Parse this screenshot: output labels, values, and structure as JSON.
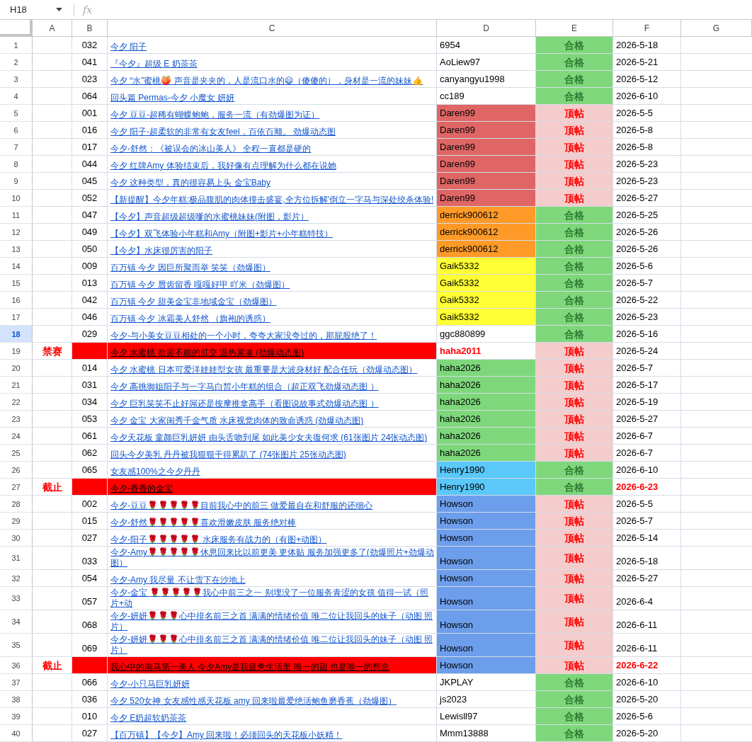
{
  "name_box": {
    "value": "H18"
  },
  "formula_bar": {
    "symbol": "fx"
  },
  "columns": [
    "A",
    "B",
    "C",
    "D",
    "E",
    "F",
    "G"
  ],
  "rows": [
    {
      "row_number": "1",
      "selected": false,
      "flagged": false,
      "column_b": "032",
      "column_c": "今夕 阳子",
      "column_d": {
        "text": "6954",
        "color": "#ffffff",
        "alert": false
      },
      "column_e": {
        "kind": "pass",
        "text": "合格"
      },
      "column_f": {
        "text": "2026-5-18",
        "alert": false
      }
    },
    {
      "row_number": "2",
      "selected": false,
      "flagged": false,
      "column_b": "041",
      "column_c": "『今夕』超级 E 奶茶茶",
      "column_d": {
        "text": "AoLiew97",
        "color": "#ffffff",
        "alert": false
      },
      "column_e": {
        "kind": "pass",
        "text": "合格"
      },
      "column_f": {
        "text": "2026-5-21",
        "alert": false
      }
    },
    {
      "row_number": "3",
      "selected": false,
      "flagged": false,
      "column_b": "023",
      "column_c": "今夕 “水”蜜桃🍑 声音是夹夹的，人是流口水的😄（傻傻的），身材是一流的妹妹👍",
      "column_d": {
        "text": "canyangyu1998",
        "color": "#ffffff",
        "alert": false
      },
      "column_e": {
        "kind": "pass",
        "text": "合格"
      },
      "column_f": {
        "text": "2026-5-12",
        "alert": false
      }
    },
    {
      "row_number": "4",
      "selected": false,
      "flagged": false,
      "column_b": "064",
      "column_c": "回头篇 Permas-今夕 小魔女 妍妍",
      "column_d": {
        "text": "cc189",
        "color": "#ffffff",
        "alert": false
      },
      "column_e": {
        "kind": "pass",
        "text": "合格"
      },
      "column_f": {
        "text": "2026-6-10",
        "alert": false
      }
    },
    {
      "row_number": "5",
      "selected": false,
      "flagged": false,
      "column_b": "001",
      "column_c": "今夕 豆豆-超稀有蝴蝶鲍鲍，服务一流（有劲爆图为证）",
      "column_d": {
        "text": "Daren99",
        "color": "#e06666",
        "alert": false
      },
      "column_e": {
        "kind": "bump",
        "text": "顶帖"
      },
      "column_f": {
        "text": "2026-5-5",
        "alert": false
      }
    },
    {
      "row_number": "6",
      "selected": false,
      "flagged": false,
      "column_b": "016",
      "column_c": "今夕 阳子-超柔软的非常有女友feel，百依百顺。 劲爆动态图",
      "column_d": {
        "text": "Daren99",
        "color": "#e06666",
        "alert": false
      },
      "column_e": {
        "kind": "bump",
        "text": "顶帖"
      },
      "column_f": {
        "text": "2026-5-8",
        "alert": false
      }
    },
    {
      "row_number": "7",
      "selected": false,
      "flagged": false,
      "column_b": "017",
      "column_c": "今夕-舒然：《被误会的冰山美人》 全程一直都是硬的",
      "column_d": {
        "text": "Daren99",
        "color": "#e06666",
        "alert": false
      },
      "column_e": {
        "kind": "bump",
        "text": "顶帖"
      },
      "column_f": {
        "text": "2026-5-8",
        "alert": false
      }
    },
    {
      "row_number": "8",
      "selected": false,
      "flagged": false,
      "column_b": "044",
      "column_c": "今夕 红牌Amy 体验结束后，我好像有点理解为什么都在说她",
      "column_d": {
        "text": "Daren99",
        "color": "#e06666",
        "alert": false
      },
      "column_e": {
        "kind": "bump",
        "text": "顶帖"
      },
      "column_f": {
        "text": "2026-5-23",
        "alert": false
      }
    },
    {
      "row_number": "9",
      "selected": false,
      "flagged": false,
      "column_b": "045",
      "column_c": "今夕 这种类型，真的很容易上头 金宝Baby",
      "column_d": {
        "text": "Daren99",
        "color": "#e06666",
        "alert": false
      },
      "column_e": {
        "kind": "bump",
        "text": "顶帖"
      },
      "column_f": {
        "text": "2026-5-23",
        "alert": false
      }
    },
    {
      "row_number": "10",
      "selected": false,
      "flagged": false,
      "column_b": "052",
      "column_c": "【新提醒】今夕年糕:极品腹肌的肉体撞击盛宴,全方位拆解'倒立一字马与深处绞杀体验!",
      "column_d": {
        "text": "Daren99",
        "color": "#e06666",
        "alert": false
      },
      "column_e": {
        "kind": "bump",
        "text": "顶帖"
      },
      "column_f": {
        "text": "2026-5-27",
        "alert": false
      }
    },
    {
      "row_number": "11",
      "selected": false,
      "flagged": false,
      "column_b": "047",
      "column_c": "【今夕】声音超级超级嗲的水蜜桃妹妹(附图，影片）",
      "column_d": {
        "text": "derrick900612",
        "color": "#ff9a28",
        "alert": false
      },
      "column_e": {
        "kind": "pass",
        "text": "合格"
      },
      "column_f": {
        "text": "2026-5-25",
        "alert": false
      }
    },
    {
      "row_number": "12",
      "selected": false,
      "flagged": false,
      "column_b": "049",
      "column_c": "【今夕】双飞体验小年糕和Amy（附图+影片+小年糕特技）",
      "column_d": {
        "text": "derrick900612",
        "color": "#ff9a28",
        "alert": false
      },
      "column_e": {
        "kind": "pass",
        "text": "合格"
      },
      "column_f": {
        "text": "2026-5-26",
        "alert": false
      }
    },
    {
      "row_number": "13",
      "selected": false,
      "flagged": false,
      "column_b": "050",
      "column_c": "【今夕】水床很厉害的阳子",
      "column_d": {
        "text": "derrick900612",
        "color": "#ff9a28",
        "alert": false
      },
      "column_e": {
        "kind": "pass",
        "text": "合格"
      },
      "column_f": {
        "text": "2026-5-26",
        "alert": false
      }
    },
    {
      "row_number": "14",
      "selected": false,
      "flagged": false,
      "column_b": "009",
      "column_c": "百万镇 今夕 因巨所聚而举 笑笑（劲爆图）",
      "column_d": {
        "text": "Gaik5332",
        "color": "#ffff33",
        "alert": false
      },
      "column_e": {
        "kind": "pass",
        "text": "合格"
      },
      "column_f": {
        "text": "2026-5-6",
        "alert": false
      }
    },
    {
      "row_number": "15",
      "selected": false,
      "flagged": false,
      "column_b": "013",
      "column_c": "百万镇 今夕 唇齿留香 嘎嘎好甲 吖米（劲爆图）",
      "column_d": {
        "text": "Gaik5332",
        "color": "#ffff33",
        "alert": false
      },
      "column_e": {
        "kind": "pass",
        "text": "合格"
      },
      "column_f": {
        "text": "2026-5-7",
        "alert": false
      }
    },
    {
      "row_number": "16",
      "selected": false,
      "flagged": false,
      "column_b": "042",
      "column_c": "百万镇 今夕 甜美金宝非地域金宝（劲爆图）",
      "column_d": {
        "text": "Gaik5332",
        "color": "#ffff33",
        "alert": false
      },
      "column_e": {
        "kind": "pass",
        "text": "合格"
      },
      "column_f": {
        "text": "2026-5-22",
        "alert": false
      }
    },
    {
      "row_number": "17",
      "selected": false,
      "flagged": false,
      "column_b": "046",
      "column_c": "百万镇 今夕 冰霜美人舒然 （旗袍的诱惑）",
      "column_d": {
        "text": "Gaik5332",
        "color": "#ffff33",
        "alert": false
      },
      "column_e": {
        "kind": "pass",
        "text": "合格"
      },
      "column_f": {
        "text": "2026-5-23",
        "alert": false
      }
    },
    {
      "row_number": "18",
      "selected": true,
      "flagged": false,
      "column_b": "029",
      "column_c": "今夕-与小美女豆豆相处的一个小时，夸夸大家没夸过的，那屁股绝了！",
      "column_d": {
        "text": "ggc880899",
        "color": "#ffffff",
        "alert": false
      },
      "column_e": {
        "kind": "pass",
        "text": "合格"
      },
      "column_f": {
        "text": "2026-5-16",
        "alert": false
      }
    },
    {
      "row_number": "19",
      "selected": false,
      "flagged": true,
      "column_a": "禁赛",
      "column_c": "今夕 水蜜桃 欲罢不能的肛交 温热紧凑 (劲爆动态图)",
      "column_d": {
        "text": "haha2011",
        "color": "#ffffff",
        "alert": true
      },
      "column_e": {
        "kind": "bump",
        "text": "顶帖"
      },
      "column_f": {
        "text": "2026-5-24",
        "alert": false
      }
    },
    {
      "row_number": "20",
      "selected": false,
      "flagged": false,
      "column_b": "014",
      "column_c": "今夕 水蜜桃 日本可爱洋娃娃型女孩 最重要是大波身材好 配合任玩（劲爆动态图）",
      "column_d": {
        "text": "haha2026",
        "color": "#7ed87b",
        "alert": false
      },
      "column_e": {
        "kind": "bump",
        "text": "顶帖"
      },
      "column_f": {
        "text": "2026-5-7",
        "alert": false
      }
    },
    {
      "row_number": "21",
      "selected": false,
      "flagged": false,
      "column_b": "031",
      "column_c": "今夕 高挑御姐阳子与一字马白皙小年糕的组合（超正双飞劲爆动态图 ）",
      "column_d": {
        "text": "haha2026",
        "color": "#7ed87b",
        "alert": false
      },
      "column_e": {
        "kind": "bump",
        "text": "顶帖"
      },
      "column_f": {
        "text": "2026-5-17",
        "alert": false
      }
    },
    {
      "row_number": "22",
      "selected": false,
      "flagged": false,
      "column_b": "034",
      "column_c": "今夕 巨乳笑笑不止好屌还是按摩推拿高手（看图说故事式劲爆动态图 ）",
      "column_d": {
        "text": "haha2026",
        "color": "#7ed87b",
        "alert": false
      },
      "column_e": {
        "kind": "bump",
        "text": "顶帖"
      },
      "column_f": {
        "text": "2026-5-19",
        "alert": false
      }
    },
    {
      "row_number": "23",
      "selected": false,
      "flagged": false,
      "column_b": "053",
      "column_c": "今夕 金宝 大家闺秀千金气质 水床视觉肉体的致命诱惑 (劲爆动态图)",
      "column_d": {
        "text": "haha2026",
        "color": "#7ed87b",
        "alert": false
      },
      "column_e": {
        "kind": "bump",
        "text": "顶帖"
      },
      "column_f": {
        "text": "2026-5-27",
        "alert": false
      }
    },
    {
      "row_number": "24",
      "selected": false,
      "flagged": false,
      "column_b": "061",
      "column_c": "今夕天花板 童颜巨乳妍妍 由头舌吻到尾 如此美少女夫復何求 (61张图片 24张动态图)",
      "column_d": {
        "text": "haha2026",
        "color": "#7ed87b",
        "alert": false
      },
      "column_e": {
        "kind": "bump",
        "text": "顶帖"
      },
      "column_f": {
        "text": "2026-6-7",
        "alert": false
      }
    },
    {
      "row_number": "25",
      "selected": false,
      "flagged": false,
      "column_b": "062",
      "column_c": "回头今夕美乳 丹丹被我狠狠干得累趴了 (74张图片 25张动态图)",
      "column_d": {
        "text": "haha2026",
        "color": "#7ed87b",
        "alert": false
      },
      "column_e": {
        "kind": "bump",
        "text": "顶帖"
      },
      "column_f": {
        "text": "2026-6-7",
        "alert": false
      }
    },
    {
      "row_number": "26",
      "selected": false,
      "flagged": false,
      "column_b": "065",
      "column_c": "女友感100%之今夕丹丹",
      "column_d": {
        "text": "Henry1990",
        "color": "#5ac8f9",
        "alert": false
      },
      "column_e": {
        "kind": "pass",
        "text": "合格"
      },
      "column_f": {
        "text": "2026-6-10",
        "alert": false
      }
    },
    {
      "row_number": "27",
      "selected": false,
      "flagged": true,
      "column_a": "截止",
      "column_c": "今夕-香香的金宝",
      "column_d": {
        "text": "Henry1990",
        "color": "#5ac8f9",
        "alert": false
      },
      "column_e": {
        "kind": "pass",
        "text": "合格"
      },
      "column_f": {
        "text": "2026-6-23",
        "alert": true
      }
    },
    {
      "row_number": "28",
      "selected": false,
      "flagged": false,
      "column_b": "002",
      "column_c": "今夕-豆豆🌹🌹🌹🌹🌹目前我心中的前三 做爱最自在和舒服的还细心",
      "column_d": {
        "text": "Howson",
        "color": "#6d9eeb",
        "alert": false
      },
      "column_e": {
        "kind": "bump",
        "text": "顶帖"
      },
      "column_f": {
        "text": "2026-5-5",
        "alert": false
      }
    },
    {
      "row_number": "29",
      "selected": false,
      "flagged": false,
      "column_b": "015",
      "column_c": "今夕-舒然🌹🌹🌹🌹🌹喜欢滑嫩皮肤 服务绝对棒",
      "column_d": {
        "text": "Howson",
        "color": "#6d9eeb",
        "alert": false
      },
      "column_e": {
        "kind": "bump",
        "text": "顶帖"
      },
      "column_f": {
        "text": "2026-5-7",
        "alert": false
      }
    },
    {
      "row_number": "30",
      "selected": false,
      "flagged": false,
      "column_b": "027",
      "column_c": "今夕-阳子🌹🌹🌹🌹🌹 水床服务有战力的（有图+动图）",
      "column_d": {
        "text": "Howson",
        "color": "#6d9eeb",
        "alert": false
      },
      "column_e": {
        "kind": "bump",
        "text": "顶帖"
      },
      "column_f": {
        "text": "2026-5-14",
        "alert": false
      }
    },
    {
      "row_number": "31",
      "selected": false,
      "flagged": false,
      "column_b": "033",
      "column_c": "今夕-Amy🌹🌹🌹🌹🌹休息回来比以前更美 更体贴 服务加强更多了(劲爆照片+劲爆动图）",
      "column_d": {
        "text": "Howson",
        "color": "#6d9eeb",
        "alert": false
      },
      "column_e": {
        "kind": "bump",
        "text": "顶帖"
      },
      "column_f": {
        "text": "2026-5-18",
        "alert": false
      }
    },
    {
      "row_number": "32",
      "selected": false,
      "flagged": false,
      "column_b": "054",
      "column_c": "今夕-Amy 我尽量 不让雪下在沙地上",
      "column_d": {
        "text": "Howson",
        "color": "#6d9eeb",
        "alert": false
      },
      "column_e": {
        "kind": "bump",
        "text": "顶帖"
      },
      "column_f": {
        "text": "2026-5-27",
        "alert": false
      }
    },
    {
      "row_number": "33",
      "selected": false,
      "flagged": false,
      "column_b": "057",
      "column_c": "今夕-金宝 🌹🌹🌹🌹🌹我心中前三之一 别埋没了一位服务青涩的女孩 值得一试（照片+动",
      "column_d": {
        "text": "Howson",
        "color": "#6d9eeb",
        "alert": false
      },
      "column_e": {
        "kind": "bump",
        "text": "顶帖"
      },
      "column_f": {
        "text": "2026-6-4",
        "alert": false
      }
    },
    {
      "row_number": "34",
      "selected": false,
      "flagged": false,
      "column_b": "068",
      "column_c": "今夕-妍妍🌹🌹🌹心中排名前三之首 满满的情绪价值 唯二位让我回头的妹子（动图 照片）",
      "column_d": {
        "text": "Howson",
        "color": "#6d9eeb",
        "alert": false
      },
      "column_e": {
        "kind": "bump",
        "text": "顶帖"
      },
      "column_f": {
        "text": "2026-6-11",
        "alert": false
      }
    },
    {
      "row_number": "35",
      "selected": false,
      "flagged": false,
      "column_b": "069",
      "column_c": "今夕-妍妍🌹🌹🌹心中排名前三之首 满满的情绪价值 唯二位让我回头的妹子（动图 照片）",
      "column_d": {
        "text": "Howson",
        "color": "#6d9eeb",
        "alert": false
      },
      "column_e": {
        "kind": "bump",
        "text": "顶帖"
      },
      "column_f": {
        "text": "2026-6-11",
        "alert": false
      }
    },
    {
      "row_number": "36",
      "selected": false,
      "flagged": true,
      "column_a": "截止",
      "column_c": "我心中的南马第一美人 今夕Amy是我疲惫生活里 唯一的甜 也是唯一的想念",
      "column_d": {
        "text": "Howson",
        "color": "#6d9eeb",
        "alert": false
      },
      "column_e": {
        "kind": "bump",
        "text": "顶帖"
      },
      "column_f": {
        "text": "2026-6-22",
        "alert": true
      }
    },
    {
      "row_number": "37",
      "selected": false,
      "flagged": false,
      "column_b": "066",
      "column_c": "今夕-小只马巨乳妍妍",
      "column_d": {
        "text": "JKPLAY",
        "color": "#ffffff",
        "alert": false
      },
      "column_e": {
        "kind": "pass",
        "text": "合格"
      },
      "column_f": {
        "text": "2026-6-10",
        "alert": false
      }
    },
    {
      "row_number": "38",
      "selected": false,
      "flagged": false,
      "column_b": "036",
      "column_c": "今夕 520女神 女友感性感天花板 amy 回来啦最爱绝活鲍鱼磨香蕉（劲爆图）",
      "column_d": {
        "text": "js2023",
        "color": "#ffffff",
        "alert": false
      },
      "column_e": {
        "kind": "pass",
        "text": "合格"
      },
      "column_f": {
        "text": "2026-5-20",
        "alert": false
      }
    },
    {
      "row_number": "39",
      "selected": false,
      "flagged": false,
      "column_b": "010",
      "column_c": "今夕 E奶超软奶茶茶",
      "column_d": {
        "text": "Lewisll97",
        "color": "#ffffff",
        "alert": false
      },
      "column_e": {
        "kind": "pass",
        "text": "合格"
      },
      "column_f": {
        "text": "2026-5-6",
        "alert": false
      }
    },
    {
      "row_number": "40",
      "selected": false,
      "flagged": false,
      "column_b": "027",
      "column_c": "【百万镇】【今夕】Amy 回来啦！必须回头的天花板小妖精！",
      "column_d": {
        "text": "Mmm13888",
        "color": "#ffffff",
        "alert": false
      },
      "column_e": {
        "kind": "pass",
        "text": "合格"
      },
      "column_f": {
        "text": "2026-5-20",
        "alert": false
      }
    }
  ]
}
